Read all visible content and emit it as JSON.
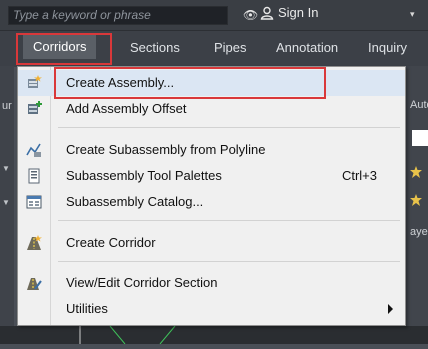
{
  "search": {
    "placeholder": "Type a keyword or phrase"
  },
  "account": {
    "sign_in_label": "Sign In"
  },
  "menubar": {
    "items": [
      {
        "label": "Corridors",
        "active": true
      },
      {
        "label": "Sections"
      },
      {
        "label": "Pipes"
      },
      {
        "label": "Annotation"
      },
      {
        "label": "Inquiry"
      }
    ]
  },
  "background": {
    "left_fragment": "ur",
    "right_fragment_1": "Auto",
    "right_fragment_2": "aye"
  },
  "dropdown": {
    "items": [
      {
        "label": "Create Assembly...",
        "icon": "create-assembly-icon"
      },
      {
        "label": "Add Assembly Offset",
        "icon": "add-assembly-offset-icon"
      },
      {
        "label": "Create Subassembly from Polyline",
        "icon": "subassembly-polyline-icon"
      },
      {
        "label": "Subassembly Tool Palettes",
        "shortcut": "Ctrl+3",
        "icon": "tool-palettes-icon"
      },
      {
        "label": "Subassembly Catalog...",
        "icon": "catalog-icon"
      },
      {
        "label": "Create Corridor",
        "icon": "create-corridor-icon"
      },
      {
        "label": "View/Edit Corridor Section",
        "icon": "corridor-section-icon"
      },
      {
        "label": "Utilities",
        "has_submenu": true
      }
    ]
  },
  "colors": {
    "highlight_red": "#d9383a",
    "menu_bg": "#f0f0f0",
    "menubar_bg": "#3c4047"
  }
}
